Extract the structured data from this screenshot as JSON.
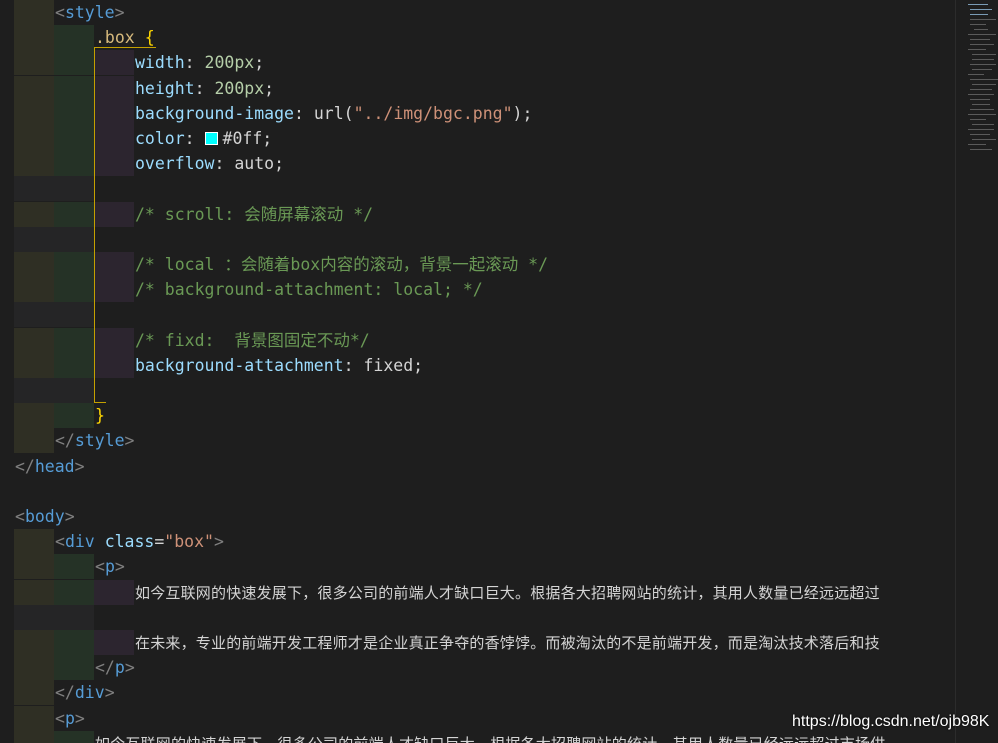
{
  "colors": {
    "background": "#1e1e1e",
    "tag_bracket": "#808080",
    "tag_name": "#569cd6",
    "attr_name": "#9cdcfe",
    "string": "#ce9178",
    "number": "#b5cea8",
    "selector": "#d7ba7d",
    "comment": "#6a9955",
    "plain": "#d4d4d4",
    "brace": "#ffd700",
    "swatch": "#00ffff",
    "indent_yellow": "#2f2f24",
    "indent_green": "#253226",
    "indent_purple": "#2c252f",
    "indent_empty": "#252526"
  },
  "editor": {
    "lines": [
      {
        "guides": [
          "y"
        ],
        "tokens": [
          [
            "<",
            "tb"
          ],
          [
            "style",
            "tag"
          ],
          [
            ">",
            "tb"
          ]
        ]
      },
      {
        "guides": [
          "y",
          "g"
        ],
        "tokens": [
          [
            ".box",
            "sel"
          ],
          [
            " ",
            "p"
          ],
          [
            "{",
            "br"
          ]
        ]
      },
      {
        "guides": [
          "y",
          "g",
          "p"
        ],
        "tokens": [
          [
            "width",
            "attr"
          ],
          [
            ": ",
            "p"
          ],
          [
            "200px",
            "num"
          ],
          [
            ";",
            "p"
          ]
        ]
      },
      {
        "guides": [
          "y",
          "g",
          "p"
        ],
        "tokens": [
          [
            "height",
            "attr"
          ],
          [
            ": ",
            "p"
          ],
          [
            "200px",
            "num"
          ],
          [
            ";",
            "p"
          ]
        ]
      },
      {
        "guides": [
          "y",
          "g",
          "p"
        ],
        "tokens": [
          [
            "background-image",
            "attr"
          ],
          [
            ": ",
            "p"
          ],
          [
            "url(",
            "p"
          ],
          [
            "\"../img/bgc.png\"",
            "str"
          ],
          [
            ");",
            "p"
          ]
        ]
      },
      {
        "guides": [
          "y",
          "g",
          "p"
        ],
        "tokens": [
          [
            "color",
            "attr"
          ],
          [
            ": ",
            "p"
          ],
          [
            "",
            "swatch"
          ],
          [
            "#0ff",
            "p"
          ],
          [
            ";",
            "p"
          ]
        ]
      },
      {
        "guides": [
          "y",
          "g",
          "p"
        ],
        "tokens": [
          [
            "overflow",
            "attr"
          ],
          [
            ": ",
            "p"
          ],
          [
            "auto",
            "p"
          ],
          [
            ";",
            "p"
          ]
        ]
      },
      {
        "guides": [
          "e",
          "e"
        ],
        "tokens": []
      },
      {
        "guides": [
          "y",
          "g",
          "p"
        ],
        "tokens": [
          [
            "/* scroll: 会随屏幕滚动 */",
            "com"
          ]
        ]
      },
      {
        "guides": [
          "e",
          "e"
        ],
        "tokens": []
      },
      {
        "guides": [
          "y",
          "g",
          "p"
        ],
        "tokens": [
          [
            "/* local ：会随着box内容的滚动，背景一起滚动 */",
            "com"
          ]
        ]
      },
      {
        "guides": [
          "y",
          "g",
          "p"
        ],
        "tokens": [
          [
            "/* background-attachment: local; */",
            "com"
          ]
        ]
      },
      {
        "guides": [
          "e",
          "e"
        ],
        "tokens": []
      },
      {
        "guides": [
          "y",
          "g",
          "p"
        ],
        "tokens": [
          [
            "/* fixd:  背景图固定不动*/",
            "com"
          ]
        ]
      },
      {
        "guides": [
          "y",
          "g",
          "p"
        ],
        "tokens": [
          [
            "background-attachment",
            "attr"
          ],
          [
            ": ",
            "p"
          ],
          [
            "fixed",
            "p"
          ],
          [
            ";",
            "p"
          ]
        ]
      },
      {
        "guides": [
          "e",
          "e"
        ],
        "tokens": []
      },
      {
        "guides": [
          "y",
          "g"
        ],
        "tokens": [
          [
            "}",
            "br"
          ]
        ]
      },
      {
        "guides": [
          "y"
        ],
        "tokens": [
          [
            "</",
            "tb"
          ],
          [
            "style",
            "tag"
          ],
          [
            ">",
            "tb"
          ]
        ]
      },
      {
        "guides": [],
        "tokens": [
          [
            "</",
            "tb"
          ],
          [
            "head",
            "tag"
          ],
          [
            ">",
            "tb"
          ]
        ]
      },
      {
        "guides": [],
        "tokens": []
      },
      {
        "guides": [],
        "tokens": [
          [
            "<",
            "tb"
          ],
          [
            "body",
            "tag"
          ],
          [
            ">",
            "tb"
          ]
        ]
      },
      {
        "guides": [
          "y"
        ],
        "tokens": [
          [
            "<",
            "tb"
          ],
          [
            "div",
            "tag"
          ],
          [
            " ",
            "p"
          ],
          [
            "class",
            "attr"
          ],
          [
            "=",
            "p"
          ],
          [
            "\"box\"",
            "str"
          ],
          [
            ">",
            "tb"
          ]
        ]
      },
      {
        "guides": [
          "y",
          "g"
        ],
        "tokens": [
          [
            "<",
            "tb"
          ],
          [
            "p",
            "tag"
          ],
          [
            ">",
            "tb"
          ]
        ]
      },
      {
        "guides": [
          "y",
          "g",
          "p"
        ],
        "tokens": [
          [
            "如今互联网的快速发展下，很多公司的前端人才缺口巨大。根据各大招聘网站的统计，其用人数量已经远远超过",
            "prose"
          ]
        ]
      },
      {
        "guides": [
          "e",
          "e"
        ],
        "tokens": []
      },
      {
        "guides": [
          "y",
          "g",
          "p"
        ],
        "tokens": [
          [
            "在未来，专业的前端开发工程师才是企业真正争夺的香饽饽。而被淘汰的不是前端开发，而是淘汰技术落后和技",
            "prose"
          ]
        ]
      },
      {
        "guides": [
          "y",
          "g"
        ],
        "tokens": [
          [
            "</",
            "tb"
          ],
          [
            "p",
            "tag"
          ],
          [
            ">",
            "tb"
          ]
        ]
      },
      {
        "guides": [
          "y"
        ],
        "tokens": [
          [
            "</",
            "tb"
          ],
          [
            "div",
            "tag"
          ],
          [
            ">",
            "tb"
          ]
        ]
      },
      {
        "guides": [
          "y"
        ],
        "tokens": [
          [
            "<",
            "tb"
          ],
          [
            "p",
            "tag"
          ],
          [
            ">",
            "tb"
          ]
        ]
      },
      {
        "guides": [
          "y",
          "g"
        ],
        "tokens": [
          [
            "如今互联网的快速发展下，很多公司的前端人才缺口巨大。根据各大招聘网站的统计，其用人数量已经远远超过市场供",
            "prose"
          ]
        ]
      }
    ]
  },
  "watermark": "https://blog.csdn.net/ojb98K"
}
